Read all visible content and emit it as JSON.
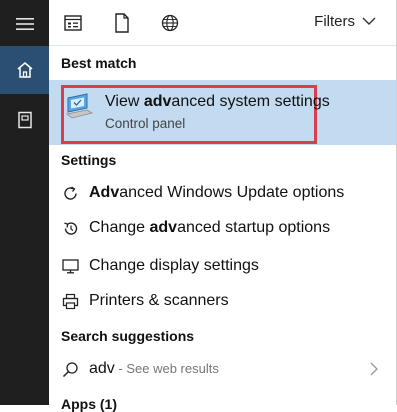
{
  "icons": {
    "menu": "hamburger-menu-icon",
    "home": "home-icon",
    "documents": "document-icon",
    "apps": "apps-icon",
    "file": "file-icon",
    "web": "globe-icon",
    "filters_chevron": "chevron-down-icon"
  },
  "toolbar": {
    "filters_label": "Filters"
  },
  "best_match": {
    "heading": "Best match",
    "title_pre": "View ",
    "title_bold": "adv",
    "title_post": "anced system settings",
    "subtitle": "Control panel"
  },
  "settings": {
    "heading": "Settings",
    "items": [
      {
        "pre": "",
        "bold": "Adv",
        "post": "anced Windows Update options",
        "icon": "refresh-icon"
      },
      {
        "pre": "Change ",
        "bold": "adv",
        "post": "anced startup options",
        "icon": "restore-icon"
      },
      {
        "pre": "Change display settings",
        "bold": "",
        "post": "",
        "icon": "monitor-icon"
      },
      {
        "pre": "Printers & scanners",
        "bold": "",
        "post": "",
        "icon": "printer-icon"
      }
    ]
  },
  "suggestions": {
    "heading": "Search suggestions",
    "query": "adv",
    "suffix": " - See web results"
  },
  "apps": {
    "heading": "Apps (1)"
  },
  "colors": {
    "rail": "#1f1f1f",
    "rail_active": "#2b4f73",
    "highlight": "#c2dbf0",
    "outline": "#d6404e"
  }
}
